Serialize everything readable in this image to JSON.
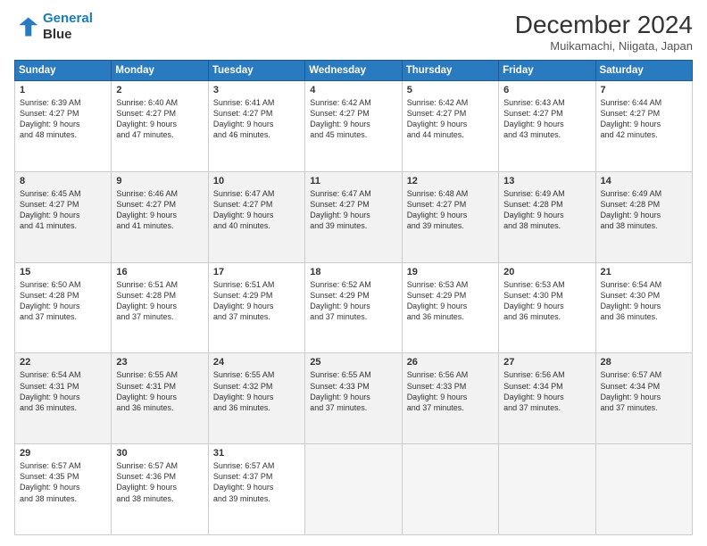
{
  "logo": {
    "line1": "General",
    "line2": "Blue"
  },
  "title": "December 2024",
  "subtitle": "Muikamachi, Niigata, Japan",
  "days_of_week": [
    "Sunday",
    "Monday",
    "Tuesday",
    "Wednesday",
    "Thursday",
    "Friday",
    "Saturday"
  ],
  "weeks": [
    [
      {
        "day": "1",
        "info": "Sunrise: 6:39 AM\nSunset: 4:27 PM\nDaylight: 9 hours\nand 48 minutes."
      },
      {
        "day": "2",
        "info": "Sunrise: 6:40 AM\nSunset: 4:27 PM\nDaylight: 9 hours\nand 47 minutes."
      },
      {
        "day": "3",
        "info": "Sunrise: 6:41 AM\nSunset: 4:27 PM\nDaylight: 9 hours\nand 46 minutes."
      },
      {
        "day": "4",
        "info": "Sunrise: 6:42 AM\nSunset: 4:27 PM\nDaylight: 9 hours\nand 45 minutes."
      },
      {
        "day": "5",
        "info": "Sunrise: 6:42 AM\nSunset: 4:27 PM\nDaylight: 9 hours\nand 44 minutes."
      },
      {
        "day": "6",
        "info": "Sunrise: 6:43 AM\nSunset: 4:27 PM\nDaylight: 9 hours\nand 43 minutes."
      },
      {
        "day": "7",
        "info": "Sunrise: 6:44 AM\nSunset: 4:27 PM\nDaylight: 9 hours\nand 42 minutes."
      }
    ],
    [
      {
        "day": "8",
        "info": "Sunrise: 6:45 AM\nSunset: 4:27 PM\nDaylight: 9 hours\nand 41 minutes."
      },
      {
        "day": "9",
        "info": "Sunrise: 6:46 AM\nSunset: 4:27 PM\nDaylight: 9 hours\nand 41 minutes."
      },
      {
        "day": "10",
        "info": "Sunrise: 6:47 AM\nSunset: 4:27 PM\nDaylight: 9 hours\nand 40 minutes."
      },
      {
        "day": "11",
        "info": "Sunrise: 6:47 AM\nSunset: 4:27 PM\nDaylight: 9 hours\nand 39 minutes."
      },
      {
        "day": "12",
        "info": "Sunrise: 6:48 AM\nSunset: 4:27 PM\nDaylight: 9 hours\nand 39 minutes."
      },
      {
        "day": "13",
        "info": "Sunrise: 6:49 AM\nSunset: 4:28 PM\nDaylight: 9 hours\nand 38 minutes."
      },
      {
        "day": "14",
        "info": "Sunrise: 6:49 AM\nSunset: 4:28 PM\nDaylight: 9 hours\nand 38 minutes."
      }
    ],
    [
      {
        "day": "15",
        "info": "Sunrise: 6:50 AM\nSunset: 4:28 PM\nDaylight: 9 hours\nand 37 minutes."
      },
      {
        "day": "16",
        "info": "Sunrise: 6:51 AM\nSunset: 4:28 PM\nDaylight: 9 hours\nand 37 minutes."
      },
      {
        "day": "17",
        "info": "Sunrise: 6:51 AM\nSunset: 4:29 PM\nDaylight: 9 hours\nand 37 minutes."
      },
      {
        "day": "18",
        "info": "Sunrise: 6:52 AM\nSunset: 4:29 PM\nDaylight: 9 hours\nand 37 minutes."
      },
      {
        "day": "19",
        "info": "Sunrise: 6:53 AM\nSunset: 4:29 PM\nDaylight: 9 hours\nand 36 minutes."
      },
      {
        "day": "20",
        "info": "Sunrise: 6:53 AM\nSunset: 4:30 PM\nDaylight: 9 hours\nand 36 minutes."
      },
      {
        "day": "21",
        "info": "Sunrise: 6:54 AM\nSunset: 4:30 PM\nDaylight: 9 hours\nand 36 minutes."
      }
    ],
    [
      {
        "day": "22",
        "info": "Sunrise: 6:54 AM\nSunset: 4:31 PM\nDaylight: 9 hours\nand 36 minutes."
      },
      {
        "day": "23",
        "info": "Sunrise: 6:55 AM\nSunset: 4:31 PM\nDaylight: 9 hours\nand 36 minutes."
      },
      {
        "day": "24",
        "info": "Sunrise: 6:55 AM\nSunset: 4:32 PM\nDaylight: 9 hours\nand 36 minutes."
      },
      {
        "day": "25",
        "info": "Sunrise: 6:55 AM\nSunset: 4:33 PM\nDaylight: 9 hours\nand 37 minutes."
      },
      {
        "day": "26",
        "info": "Sunrise: 6:56 AM\nSunset: 4:33 PM\nDaylight: 9 hours\nand 37 minutes."
      },
      {
        "day": "27",
        "info": "Sunrise: 6:56 AM\nSunset: 4:34 PM\nDaylight: 9 hours\nand 37 minutes."
      },
      {
        "day": "28",
        "info": "Sunrise: 6:57 AM\nSunset: 4:34 PM\nDaylight: 9 hours\nand 37 minutes."
      }
    ],
    [
      {
        "day": "29",
        "info": "Sunrise: 6:57 AM\nSunset: 4:35 PM\nDaylight: 9 hours\nand 38 minutes."
      },
      {
        "day": "30",
        "info": "Sunrise: 6:57 AM\nSunset: 4:36 PM\nDaylight: 9 hours\nand 38 minutes."
      },
      {
        "day": "31",
        "info": "Sunrise: 6:57 AM\nSunset: 4:37 PM\nDaylight: 9 hours\nand 39 minutes."
      },
      {
        "day": "",
        "info": ""
      },
      {
        "day": "",
        "info": ""
      },
      {
        "day": "",
        "info": ""
      },
      {
        "day": "",
        "info": ""
      }
    ]
  ]
}
